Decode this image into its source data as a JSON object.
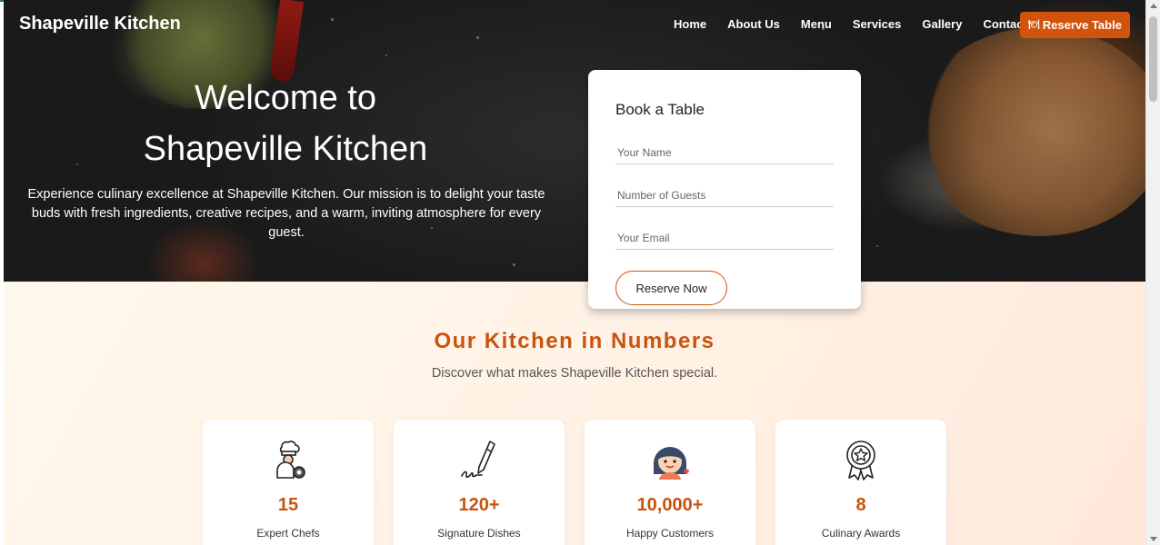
{
  "brand": "Shapeville Kitchen",
  "nav": {
    "items": [
      "Home",
      "About Us",
      "Menu",
      "Services",
      "Gallery",
      "Contact"
    ],
    "reserve_label": "Reserve Table"
  },
  "hero": {
    "title_line1": "Welcome to",
    "title_line2": "Shapeville Kitchen",
    "subtitle": "Experience culinary excellence at Shapeville Kitchen. Our mission is to delight your taste buds with fresh ingredients, creative recipes, and a warm, inviting atmosphere for every guest."
  },
  "booking": {
    "title": "Book a Table",
    "name_placeholder": "Your Name",
    "guests_placeholder": "Number of Guests",
    "email_placeholder": "Your Email",
    "submit_label": "Reserve Now"
  },
  "numbers": {
    "title": "Our Kitchen in Numbers",
    "subtitle": "Discover what makes Shapeville Kitchen special.",
    "stats": [
      {
        "value": "15",
        "label": "Expert Chefs",
        "icon": "chef-icon"
      },
      {
        "value": "120+",
        "label": "Signature Dishes",
        "icon": "pen-signature-icon"
      },
      {
        "value": "10,000+",
        "label": "Happy Customers",
        "icon": "happy-customer-icon"
      },
      {
        "value": "8",
        "label": "Culinary Awards",
        "icon": "award-badge-icon"
      }
    ]
  },
  "colors": {
    "accent": "#d2540c",
    "heading": "#c9530f"
  }
}
